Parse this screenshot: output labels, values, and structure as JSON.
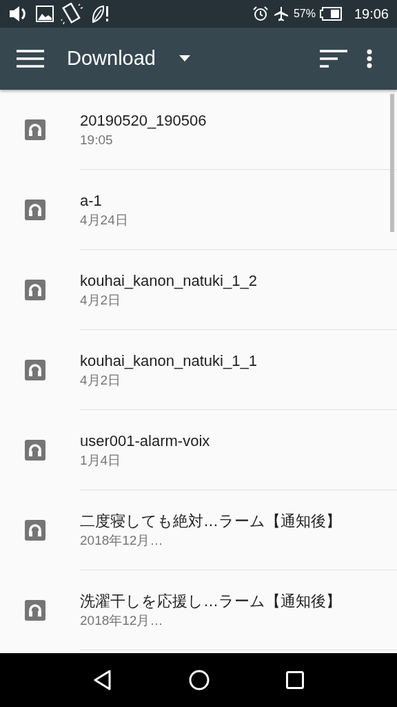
{
  "status_bar": {
    "battery_percent": "57%",
    "time": "19:06"
  },
  "app_bar": {
    "title": "Download"
  },
  "files": [
    {
      "name": "20190520_190506",
      "date": "19:05"
    },
    {
      "name": "a-1",
      "date": "4月24日"
    },
    {
      "name": "kouhai_kanon_natuki_1_2",
      "date": "4月2日"
    },
    {
      "name": "kouhai_kanon_natuki_1_1",
      "date": "4月2日"
    },
    {
      "name": "user001-alarm-voix",
      "date": "1月4日"
    },
    {
      "name": "二度寝しても絶対…ラーム【通知後】",
      "date": "2018年12月…"
    },
    {
      "name": "洗濯干しを応援し…ラーム【通知後】",
      "date": "2018年12月…"
    }
  ]
}
